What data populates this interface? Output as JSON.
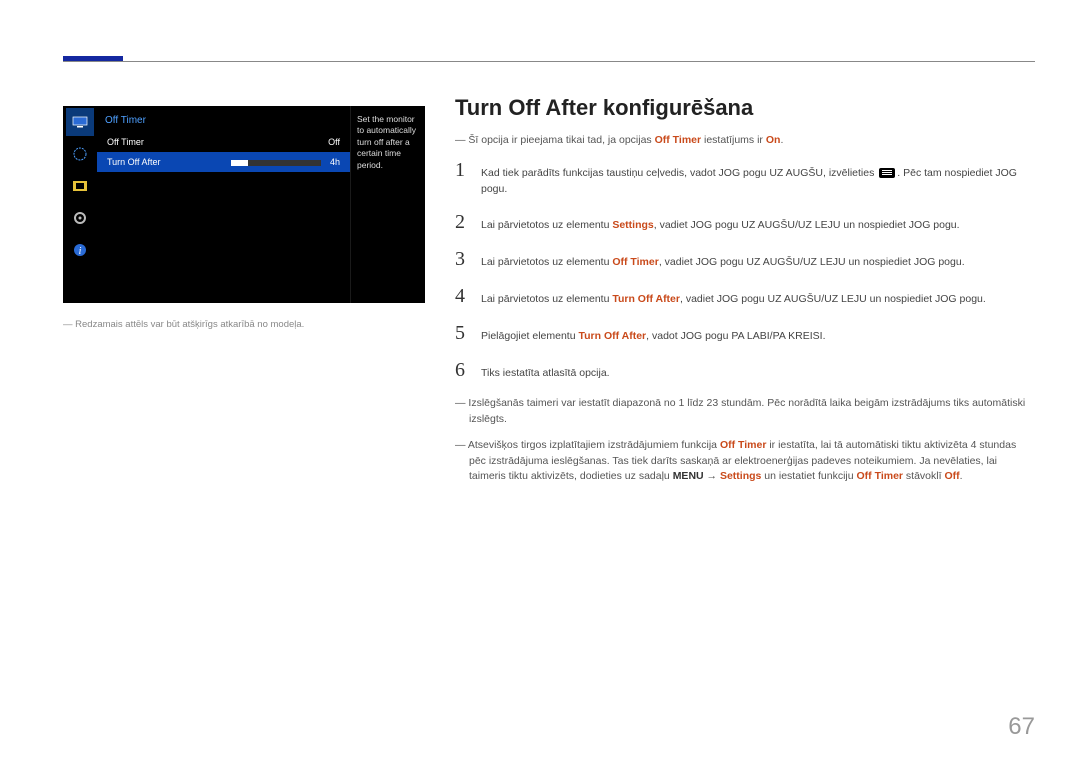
{
  "page_number": "67",
  "heading": "Turn Off After konfigurēšana",
  "osd": {
    "title": "Off Timer",
    "row1_label": "Off Timer",
    "row1_value": "Off",
    "row2_label": "Turn Off After",
    "row2_value": "4h",
    "desc": "Set the monitor to automatically turn off after a certain time period."
  },
  "left_footnote": "―  Redzamais attēls var būt atšķirīgs atkarībā no modeļa.",
  "intro_note_pre": "―  Šī opcija ir pieejama tikai tad, ja opcijas ",
  "intro_note_hl": "Off Timer",
  "intro_note_mid": " iestatījums ir ",
  "intro_note_hl2": "On",
  "intro_note_post": ".",
  "steps": {
    "s1a": "Kad tiek parādīts funkcijas taustiņu ceļvedis, vadot JOG pogu UZ AUGŠU, izvēlieties ",
    "s1b": ". Pēc tam nospiediet JOG pogu.",
    "s2a": "Lai pārvietotos uz elementu ",
    "s2_hl": "Settings",
    "s2b": ", vadiet JOG pogu UZ AUGŠU/UZ LEJU un nospiediet JOG pogu.",
    "s3a": "Lai pārvietotos uz elementu ",
    "s3_hl": "Off Timer",
    "s3b": ", vadiet JOG pogu UZ AUGŠU/UZ LEJU un nospiediet JOG pogu.",
    "s4a": "Lai pārvietotos uz elementu ",
    "s4_hl": "Turn Off After",
    "s4b": ", vadiet JOG pogu UZ AUGŠU/UZ LEJU un nospiediet JOG pogu.",
    "s5a": "Pielāgojiet elementu ",
    "s5_hl": "Turn Off After",
    "s5b": ", vadot JOG pogu PA LABI/PA KREISI.",
    "s6": "Tiks iestatīta atlasītā opcija."
  },
  "foot1a": "―  Izslēgšanās taimeri var iestatīt diapazonā no 1 līdz 23 stundām. Pēc norādītā laika beigām izstrādājums tiks automātiski izslēgts.",
  "foot2a": "―  Atsevišķos tirgos izplatītajiem izstrādājumiem funkcija ",
  "foot2_hl1": "Off Timer",
  "foot2b": " ir iestatīta, lai tā automātiski tiktu aktivizēta 4 stundas pēc izstrādājuma ieslēgšanas. Tas tiek darīts saskaņā ar elektroenerģijas padeves noteikumiem. Ja nevēlaties, lai taimeris tiktu aktivizēts, dodieties uz sadaļu ",
  "foot2_menu": "MENU",
  "foot2_arrow": " → ",
  "foot2_hl2": "Settings",
  "foot2c": " un iestatiet funkciju ",
  "foot2_hl3": "Off Timer",
  "foot2d": " stāvoklī ",
  "foot2_hl4": "Off",
  "foot2e": "."
}
